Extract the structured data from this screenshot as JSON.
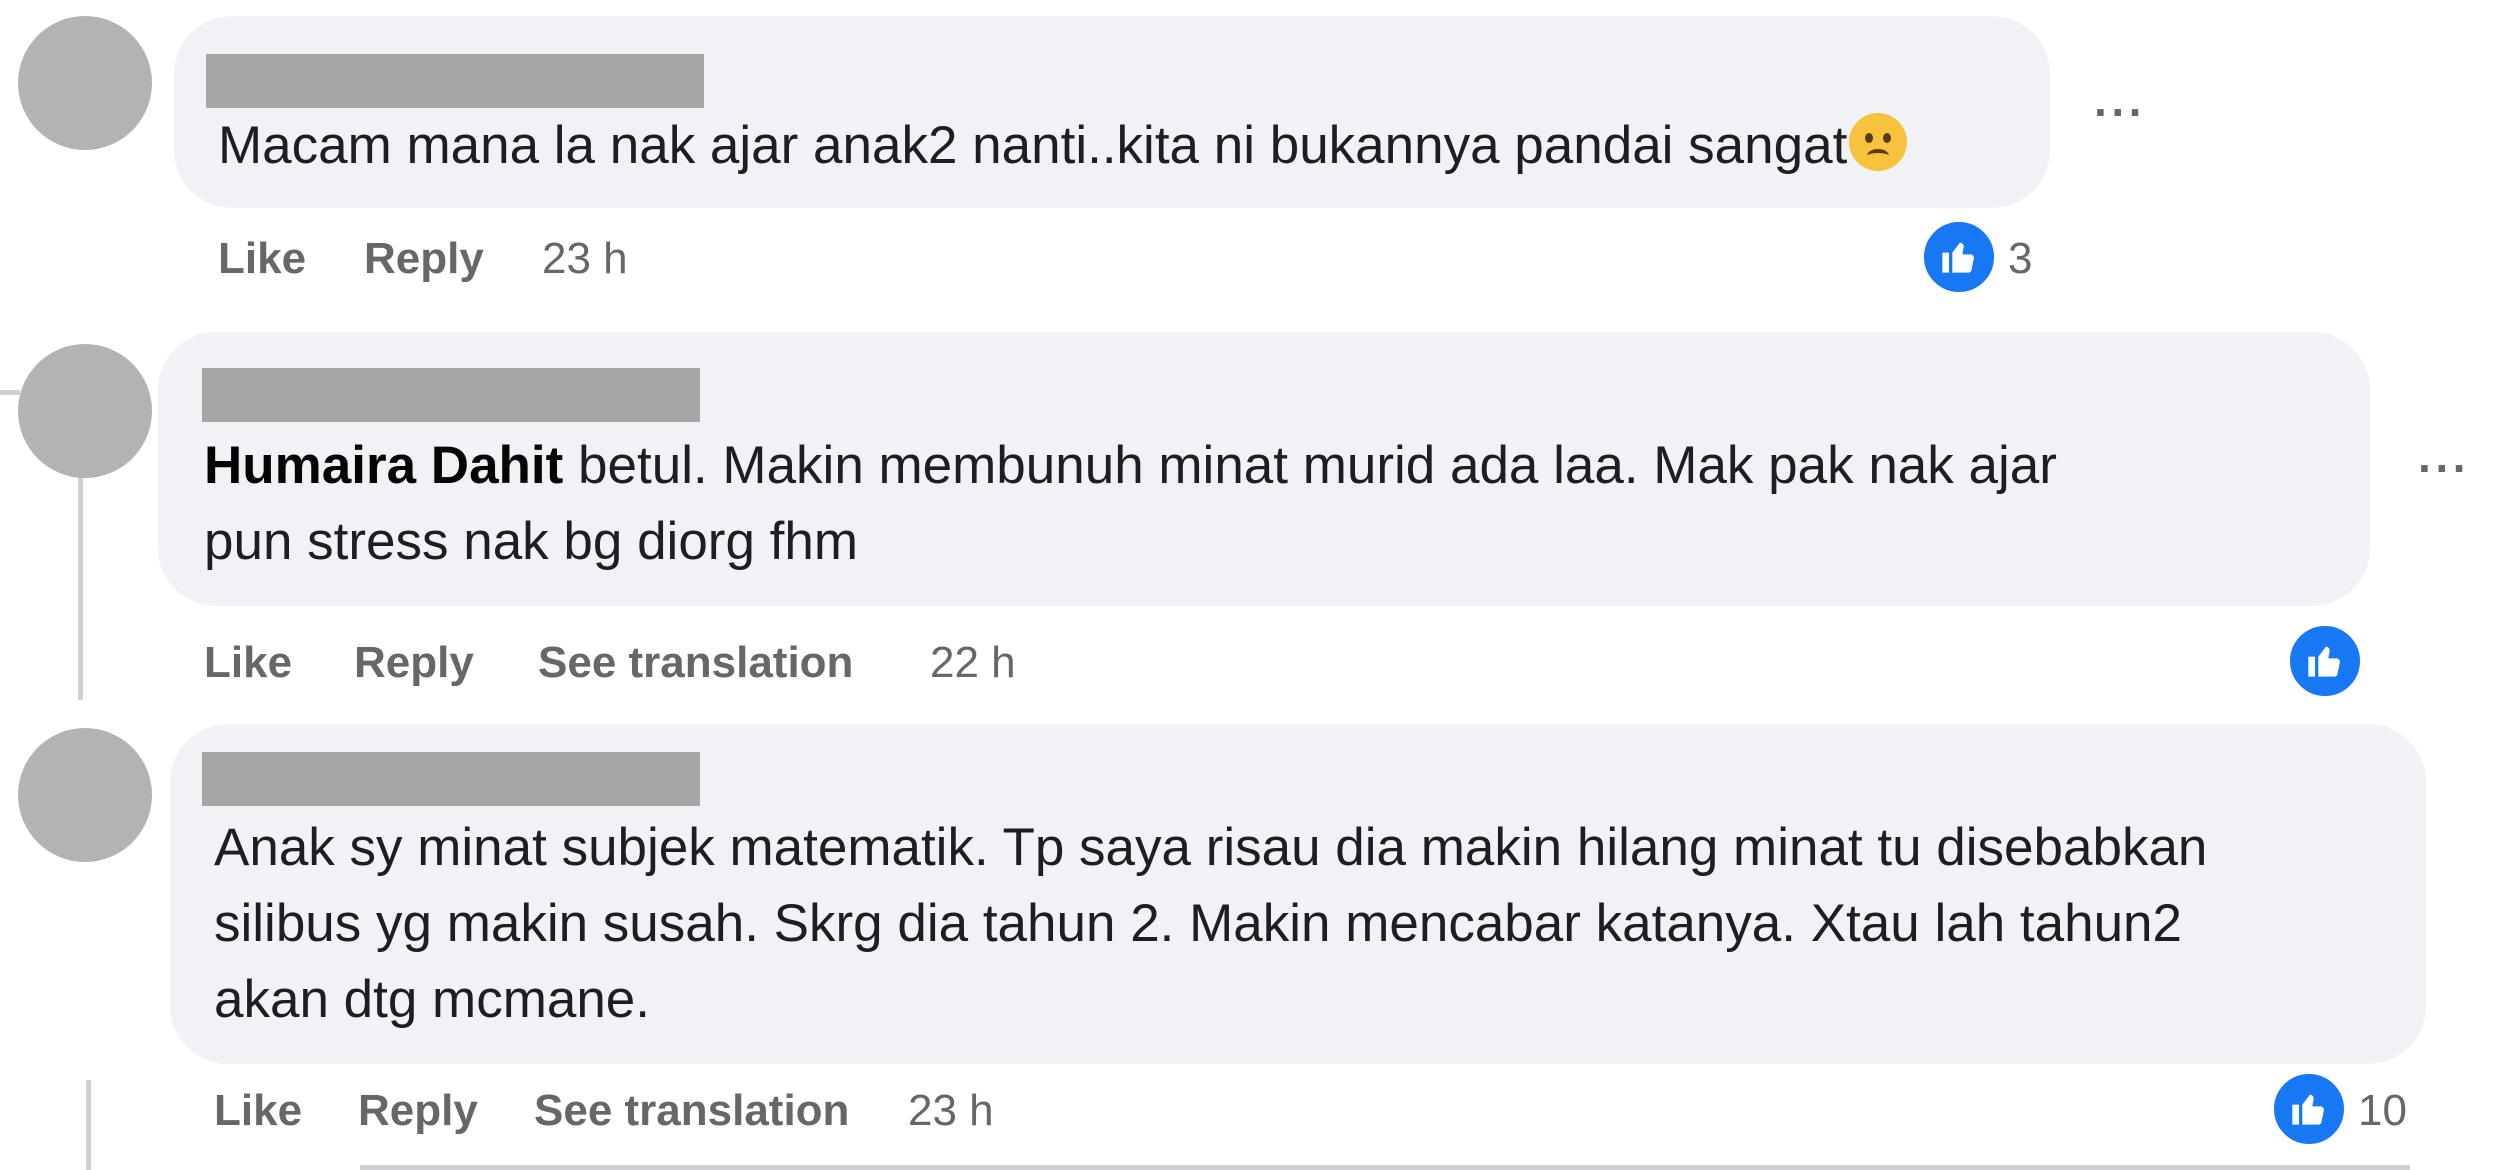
{
  "comments": [
    {
      "text": "Macam mana la nak ajar anak2 nanti..kita ni bukannya pandai sangat",
      "emoji": "worried-face",
      "actions": {
        "like": "Like",
        "reply": "Reply"
      },
      "time": "23 h",
      "reaction_count": "3",
      "more": "···"
    },
    {
      "mention": "Humaira Dahit",
      "lines": [
        " betul. Makin membunuh minat murid ada laa. Mak pak nak ajar",
        "pun stress nak bg diorg fhm"
      ],
      "actions": {
        "like": "Like",
        "reply": "Reply",
        "translate": "See translation"
      },
      "time": "22 h",
      "reaction_count": "",
      "more": "···"
    },
    {
      "lines": [
        "Anak sy minat subjek matematik. Tp saya risau dia makin hilang minat tu disebabkan",
        "silibus yg makin susah. Skrg dia tahun 2. Makin mencabar katanya. Xtau lah tahun2",
        "akan dtg mcmane."
      ],
      "actions": {
        "like": "Like",
        "reply": "Reply",
        "translate": "See translation"
      },
      "time": "23 h",
      "reaction_count": "10"
    }
  ],
  "colors": {
    "bubble": "#f0f2f5",
    "like_blue": "#1877f2",
    "meta_gray": "#65676b",
    "avatar_gray": "#b3b3b3",
    "redaction_gray": "#a6a6a6"
  }
}
